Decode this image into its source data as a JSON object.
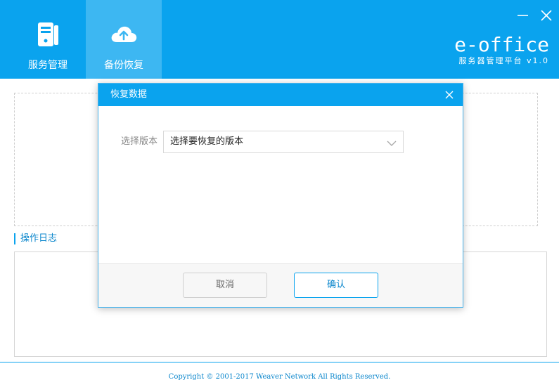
{
  "nav": {
    "items": [
      {
        "label": "服务管理",
        "icon": "server-icon",
        "active": false
      },
      {
        "label": "备份恢复",
        "icon": "cloud-upload-icon",
        "active": true
      }
    ]
  },
  "brand": {
    "name": "e-office",
    "subtitle": "服务器管理平台 v1.0"
  },
  "log": {
    "title": "操作日志"
  },
  "footer": {
    "copyright": "Copyright © 2001-2017 Weaver Network All Rights Reserved."
  },
  "modal": {
    "title": "恢复数据",
    "field_label": "选择版本",
    "select_value": "选择要恢复的版本",
    "cancel_label": "取消",
    "confirm_label": "确认"
  },
  "colors": {
    "header": "#0aa3ee",
    "nav_active": "#3db7f2",
    "accent_text": "#0a86cc"
  }
}
